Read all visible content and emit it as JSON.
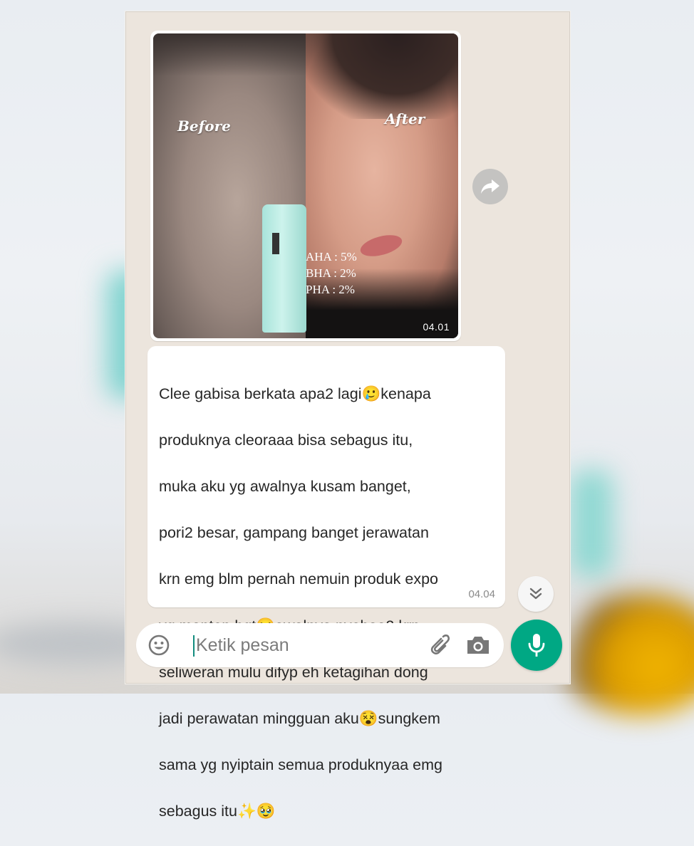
{
  "image_message": {
    "label_before": "Before",
    "label_after": "After",
    "acids": [
      "AHA : 5%",
      "BHA : 2%",
      "PHA : 2%"
    ],
    "time": "04.01"
  },
  "text_message": {
    "lines": [
      "Clee gabisa berkata apa2 lagi🥲kenapa",
      "produknya cleoraaa bisa sebagus itu,",
      "muka aku yg awalnya kusam banget,",
      "pori2 besar, gampang banget jerawatan",
      "krn emg blm pernah nemuin produk expo",
      "yg mantep bgt🤧awalnya nyobaa2 krn",
      "seliweran mulu difyp eh ketagihan dong",
      "jadi perawatan mingguan aku😵sungkem",
      "sama yg nyiptain semua produknyaa emg",
      "sebagus itu✨🥹"
    ],
    "time": "04.04"
  },
  "composer": {
    "placeholder": "Ketik pesan"
  },
  "colors": {
    "chat_bg": "#ece5dd",
    "accent": "#00a884",
    "bubble": "#ffffff"
  },
  "icons": [
    "forward-icon",
    "scroll-down-icon",
    "emoji-icon",
    "attach-icon",
    "camera-icon",
    "mic-icon"
  ]
}
